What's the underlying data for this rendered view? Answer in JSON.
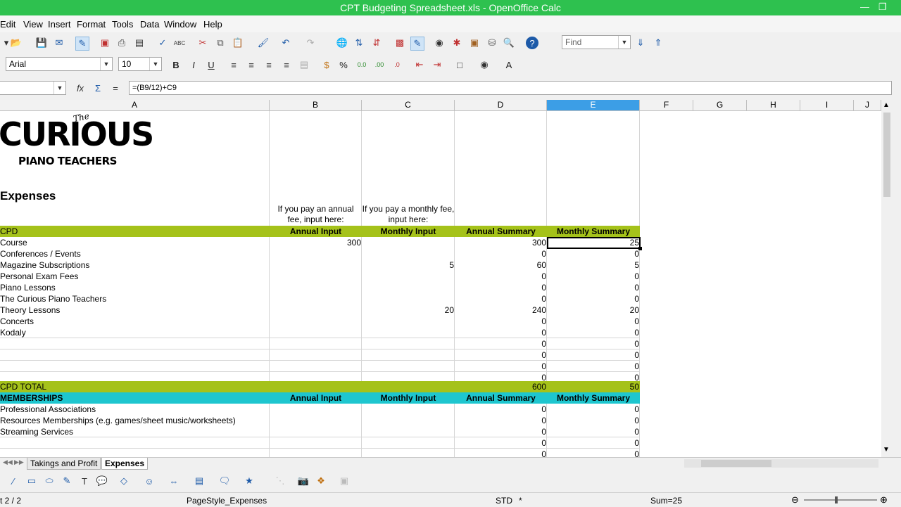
{
  "window": {
    "title": "CPT Budgeting Spreadsheet.xls - OpenOffice Calc"
  },
  "menu": [
    "Edit",
    "View",
    "Insert",
    "Format",
    "Tools",
    "Data",
    "Window",
    "Help"
  ],
  "toolbar": {
    "find_placeholder": "Find"
  },
  "format": {
    "font_name": "Arial",
    "font_size": "10"
  },
  "formula_bar": {
    "name_box": "",
    "formula": "=(B9/12)+C9"
  },
  "columns": [
    "A",
    "B",
    "C",
    "D",
    "E",
    "F",
    "G",
    "H",
    "I",
    "J"
  ],
  "active_column": "E",
  "logo": {
    "line1": "The",
    "line2": "CURIOUS",
    "line3": "PIANO TEACHERS"
  },
  "sheet": {
    "heading": "Expenses",
    "note_b": "If you pay an annual fee, input here:",
    "note_c": "If you pay a monthly fee, input here:",
    "cpd": {
      "section": "CPD",
      "headers": [
        "Annual Input",
        "Monthly Input",
        "Annual Summary",
        "Monthly Summary"
      ],
      "rows": [
        {
          "label": "Course",
          "b": "300",
          "c": "",
          "d": "300",
          "e": "25"
        },
        {
          "label": "Conferences / Events",
          "b": "",
          "c": "",
          "d": "0",
          "e": "0"
        },
        {
          "label": "Magazine Subscriptions",
          "b": "",
          "c": "5",
          "d": "60",
          "e": "5"
        },
        {
          "label": "Personal Exam Fees",
          "b": "",
          "c": "",
          "d": "0",
          "e": "0"
        },
        {
          "label": "Piano Lessons",
          "b": "",
          "c": "",
          "d": "0",
          "e": "0"
        },
        {
          "label": "The Curious Piano Teachers",
          "b": "",
          "c": "",
          "d": "0",
          "e": "0"
        },
        {
          "label": "Theory Lessons",
          "b": "",
          "c": "20",
          "d": "240",
          "e": "20"
        },
        {
          "label": "Concerts",
          "b": "",
          "c": "",
          "d": "0",
          "e": "0"
        },
        {
          "label": "Kodaly",
          "b": "",
          "c": "",
          "d": "0",
          "e": "0"
        },
        {
          "label": "",
          "b": "",
          "c": "",
          "d": "0",
          "e": "0"
        },
        {
          "label": "",
          "b": "",
          "c": "",
          "d": "0",
          "e": "0"
        },
        {
          "label": "",
          "b": "",
          "c": "",
          "d": "0",
          "e": "0"
        },
        {
          "label": "",
          "b": "",
          "c": "",
          "d": "0",
          "e": "0"
        }
      ],
      "total": {
        "label": "CPD TOTAL",
        "d": "600",
        "e": "50"
      }
    },
    "memberships": {
      "section": "MEMBERSHIPS",
      "headers": [
        "Annual Input",
        "Monthly Input",
        "Annual Summary",
        "Monthly Summary"
      ],
      "rows": [
        {
          "label": "Professional Associations",
          "d": "0",
          "e": "0"
        },
        {
          "label": "Resources Memberships (e.g. games/sheet music/worksheets)",
          "d": "0",
          "e": "0"
        },
        {
          "label": "Streaming Services",
          "d": "0",
          "e": "0"
        },
        {
          "label": "",
          "d": "0",
          "e": "0"
        },
        {
          "label": "",
          "d": "0",
          "e": "0"
        }
      ]
    }
  },
  "tabs": [
    "Takings and Profit",
    "Expenses"
  ],
  "status": {
    "sheet": "t 2 / 2",
    "page_style": "PageStyle_Expenses",
    "mode": "STD",
    "modified": "*",
    "sum": "Sum=25"
  },
  "colors": {
    "green_band": "#a5c21a",
    "teal_band": "#1ec6cf",
    "title_bar": "#2ec14f",
    "active_col": "#3c9ee6"
  }
}
